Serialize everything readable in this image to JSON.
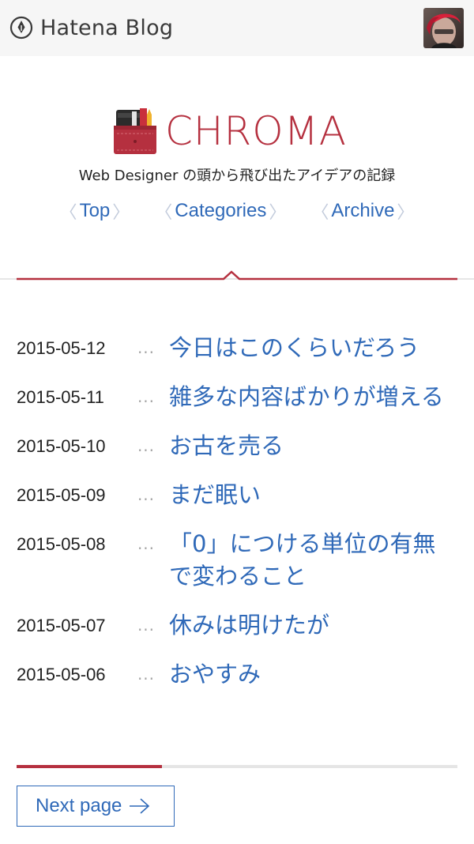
{
  "header": {
    "brand": "Hatena Blog",
    "avatar_alt": "user avatar"
  },
  "blog": {
    "title": "CHROMA",
    "tagline": "Web Designer の頭から飛び出たアイデアの記録",
    "nav": [
      {
        "label": "Top"
      },
      {
        "label": "Categories"
      },
      {
        "label": "Archive"
      }
    ]
  },
  "entries": [
    {
      "date": "2015-05-12",
      "dots": "...",
      "title": "今日はこのくらいだろう"
    },
    {
      "date": "2015-05-11",
      "dots": "...",
      "title": "雑多な内容ばかりが増える"
    },
    {
      "date": "2015-05-10",
      "dots": "...",
      "title": "お古を売る"
    },
    {
      "date": "2015-05-09",
      "dots": "...",
      "title": "まだ眠い"
    },
    {
      "date": "2015-05-08",
      "dots": "...",
      "title": "「0」につける単位の有無で変わること"
    },
    {
      "date": "2015-05-07",
      "dots": "...",
      "title": "休みは明けたが"
    },
    {
      "date": "2015-05-06",
      "dots": "...",
      "title": "おやすみ"
    }
  ],
  "pager": {
    "next_label": "Next page"
  },
  "colors": {
    "accent": "#b5303f",
    "link": "#2f69b8",
    "topbar_bg": "#f6f6f6"
  },
  "icons": {
    "brand": "hatena-pen-icon",
    "logo": "pencil-case-icon",
    "next": "arrow-right-icon"
  }
}
